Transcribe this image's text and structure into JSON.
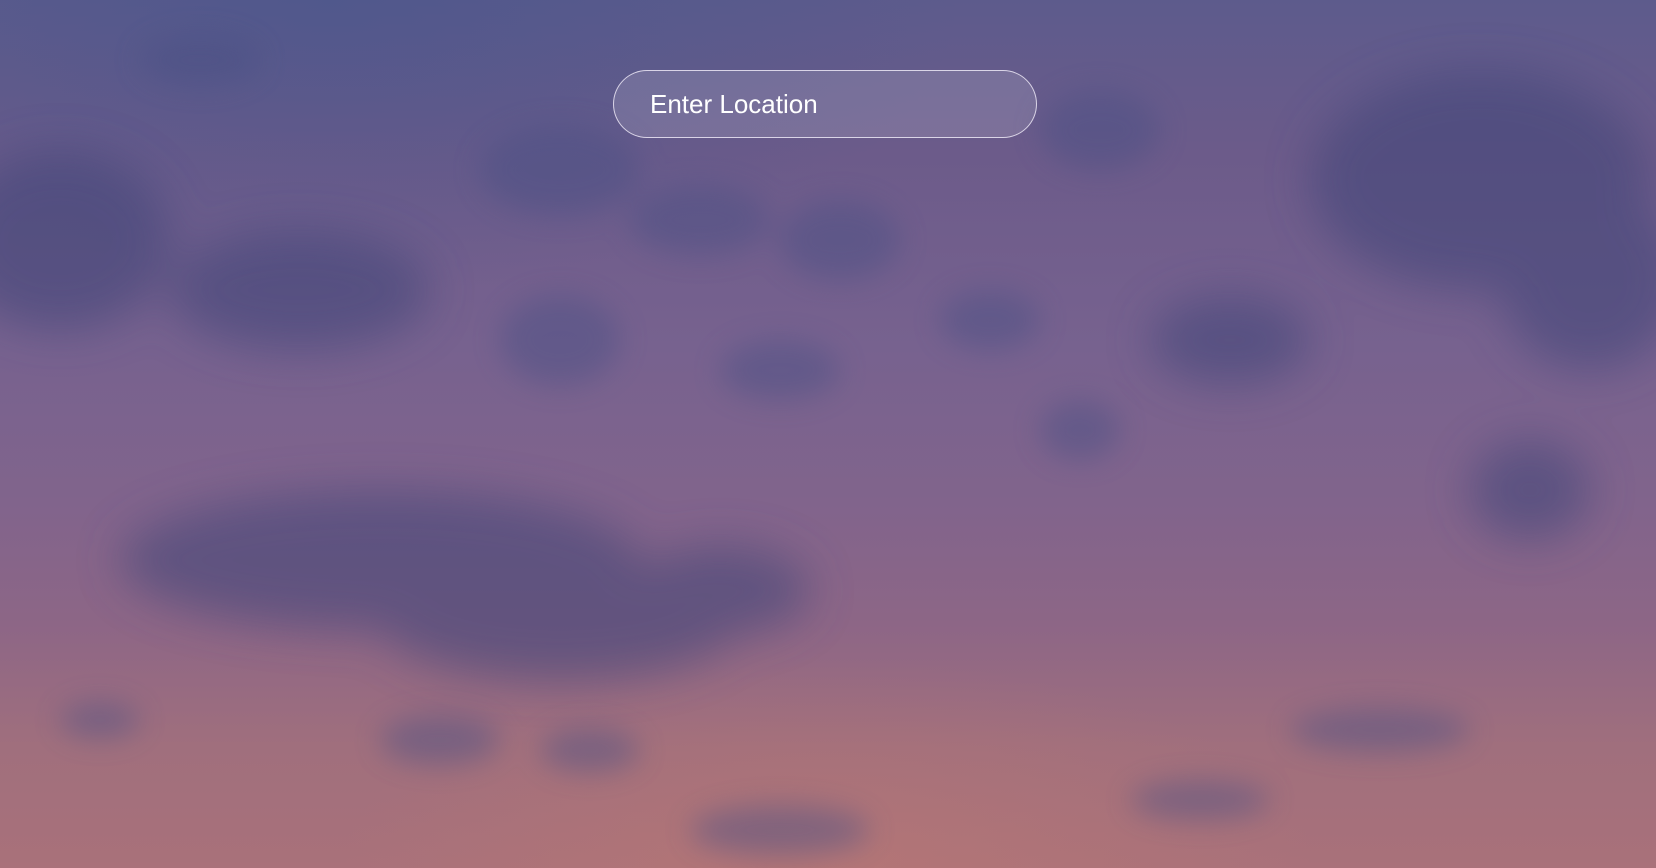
{
  "search": {
    "placeholder": "Enter Location",
    "value": ""
  },
  "background": {
    "description_icon": "sunset-sky-background",
    "colors": {
      "sky_top": "#5d5b8c",
      "sky_mid": "#77628f",
      "sky_bottom": "#a9717a",
      "cloud": "#3f4478"
    }
  }
}
